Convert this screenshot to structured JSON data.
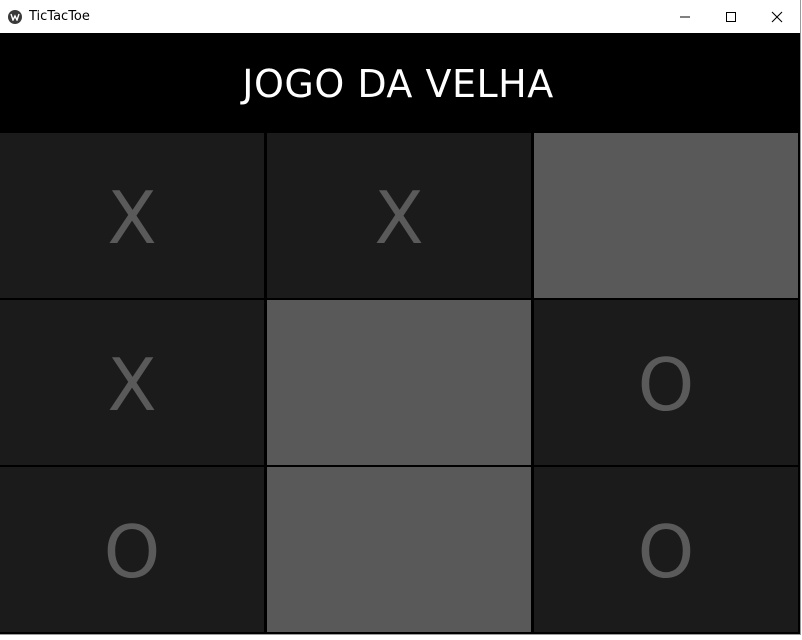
{
  "window": {
    "title": "TicTacToe",
    "icon": "kivy-app-icon",
    "controls": [
      "minimize",
      "maximize",
      "close"
    ]
  },
  "header": {
    "title": "JOGO DA VELHA"
  },
  "board": {
    "cells": [
      {
        "mark": "X",
        "state": "filled"
      },
      {
        "mark": "X",
        "state": "filled"
      },
      {
        "mark": "",
        "state": "empty"
      },
      {
        "mark": "X",
        "state": "filled"
      },
      {
        "mark": "",
        "state": "empty"
      },
      {
        "mark": "O",
        "state": "filled"
      },
      {
        "mark": "O",
        "state": "filled"
      },
      {
        "mark": "",
        "state": "empty"
      },
      {
        "mark": "O",
        "state": "filled"
      }
    ]
  },
  "colors": {
    "header_bg": "#000000",
    "header_text": "#ffffff",
    "cell_filled_bg": "#1b1b1b",
    "cell_empty_bg": "#595959",
    "mark_color": "#5a5a5a"
  }
}
